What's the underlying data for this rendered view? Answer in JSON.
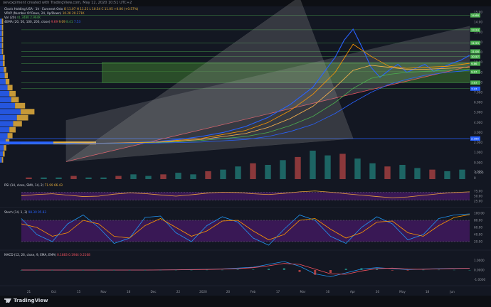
{
  "header": {
    "creator": "oevoxplment created with TradingView.com, May 12, 2020 10:51 UTC+2"
  },
  "legends": {
    "symbol": "Clovis Holding USA · 1h · Euronext Oslo",
    "symbol_values": "O 11.07  H 11.21  L 10.54  C 11.05  +0.06 (+0.57%)",
    "vrvp": "VRVP (Number Of Rows, 24, Up/Down)",
    "vrvp_values": "10.2K  20.271K",
    "vol": "Vol (20)",
    "vol_values": "41.348K  2.964K",
    "ema": "4EMA (20, 50, 100, 200, close)",
    "ema_values": [
      "9.69",
      "9.09",
      "8.41",
      "7.53"
    ],
    "rsi": "RSI (14, close, SMA, 14, 2)",
    "rsi_values": "71.99  66.43",
    "stoch": "Stoch (14, 1, 3)",
    "stoch_values": "98.30  95.83",
    "macd": "MACD (12, 26, close, 9, EMA, EMA)",
    "macd_values": "0.1883  0.1944  0.2168"
  },
  "brand": {
    "name": "TradingView"
  },
  "colors": {
    "background": "#131722",
    "candle_line": "#2962ff",
    "ema_fast": "#ff9800",
    "ema_mid": "#ffb74d",
    "ema_slow": "#4caf50",
    "ema_long": "#2962ff",
    "zone": "#3d7a2f",
    "channel": "#c8c8c8",
    "resistance": "#f7525f",
    "rsi_line": "#e8a33a",
    "stoch_k": "#2196f3",
    "stoch_d": "#ff9800",
    "band": "#4a1a6b",
    "profile_up": "#2962ff",
    "profile_down": "#e8b03c"
  },
  "chart_data": [
    {
      "type": "line",
      "role": "price",
      "x_ticks": [
        "21",
        "Oct",
        "15",
        "Nov",
        "18",
        "Dec",
        "22",
        "2020",
        "20",
        "Feb",
        "17",
        "Mar",
        "16",
        "Apr",
        "20",
        "May",
        "18",
        "Jun"
      ],
      "y_ticks": [
        "-1.000",
        "0.000",
        "1.000",
        "2.000",
        "3.000",
        "4.000",
        "5.000",
        "6.000",
        "7.000",
        "8.000",
        "9.000",
        "10.00",
        "11.00",
        "12.00",
        "13.00",
        "14.00",
        "15.00"
      ],
      "ylim": [
        -1.5,
        15.5
      ],
      "price_labels": [
        {
          "value": 14.68,
          "text": "14.68",
          "color": "#4caf50"
        },
        {
          "value": 13.24,
          "text": "13.24",
          "color": "#4caf50"
        },
        {
          "value": 11.93,
          "text": "11.93",
          "color": "#4caf50"
        },
        {
          "value": 11.08,
          "text": "11.08",
          "color": "#4caf50"
        },
        {
          "value": 10.57,
          "text": "10.57",
          "color": "#4caf50"
        },
        {
          "value": 9.86,
          "text": "9.86",
          "color": "#4caf50"
        },
        {
          "value": 9.07,
          "text": "9.07",
          "color": "#4caf50"
        },
        {
          "value": 7.97,
          "text": "7.97",
          "color": "#4caf50"
        },
        {
          "value": 7.37,
          "text": "7.37",
          "color": "#2962ff"
        },
        {
          "value": 2.395,
          "text": "2.395",
          "color": "#2962ff"
        }
      ],
      "series": [
        {
          "key": "price",
          "x": [
            0,
            5,
            10,
            15,
            20,
            25,
            30,
            35,
            40,
            45,
            50,
            55,
            60,
            65,
            70,
            72,
            74,
            76,
            78,
            80,
            82,
            84,
            86,
            88,
            90,
            92,
            94,
            96,
            98,
            100
          ],
          "values": [
            1.95,
            1.9,
            1.85,
            1.9,
            1.95,
            2.0,
            2.1,
            2.3,
            2.6,
            3.0,
            3.6,
            4.5,
            5.8,
            7.5,
            10.5,
            12.2,
            13.3,
            11.5,
            9.5,
            8.5,
            9.2,
            9.8,
            9.0,
            9.4,
            9.8,
            9.1,
            9.5,
            9.9,
            10.2,
            10.7
          ]
        },
        {
          "key": "ema20",
          "x": [
            0,
            10,
            20,
            30,
            40,
            50,
            55,
            60,
            65,
            70,
            74,
            78,
            82,
            86,
            90,
            95,
            100
          ],
          "values": [
            1.9,
            1.9,
            1.95,
            2.05,
            2.4,
            3.2,
            4.0,
            5.2,
            6.8,
            9.0,
            11.8,
            10.6,
            9.6,
            9.4,
            9.5,
            9.6,
            9.9
          ]
        },
        {
          "key": "ema50",
          "x": [
            0,
            10,
            20,
            30,
            40,
            50,
            55,
            60,
            65,
            70,
            74,
            78,
            82,
            86,
            90,
            95,
            100
          ],
          "values": [
            1.9,
            1.9,
            1.93,
            2.0,
            2.3,
            2.9,
            3.5,
            4.4,
            5.6,
            7.5,
            9.2,
            9.7,
            9.5,
            9.3,
            9.3,
            9.4,
            9.5
          ]
        },
        {
          "key": "ema100",
          "x": [
            0,
            10,
            20,
            30,
            40,
            50,
            55,
            60,
            65,
            70,
            74,
            78,
            82,
            86,
            90,
            95,
            100
          ],
          "values": [
            1.9,
            1.9,
            1.92,
            1.98,
            2.2,
            2.6,
            3.0,
            3.7,
            4.6,
            6.0,
            7.4,
            8.4,
            8.8,
            9.0,
            9.1,
            9.2,
            9.3
          ]
        },
        {
          "key": "ema200",
          "x": [
            0,
            10,
            20,
            30,
            40,
            50,
            55,
            60,
            65,
            70,
            74,
            78,
            82,
            86,
            90,
            95,
            100
          ],
          "values": [
            1.9,
            1.9,
            1.91,
            1.95,
            2.05,
            2.3,
            2.6,
            3.1,
            3.8,
            4.9,
            6.0,
            7.0,
            7.8,
            8.3,
            8.7,
            9.0,
            9.2
          ]
        }
      ],
      "zone": {
        "from_x": 18,
        "to_x": 100,
        "y_low": 7.97,
        "y_high": 10.0
      },
      "support_level": 2.395,
      "horizontal_levels": [
        14.68,
        13.24,
        11.93,
        11.08,
        10.57,
        9.86,
        9.07,
        7.97,
        7.37
      ],
      "channel": {
        "lower_start": [
          10,
          0.1
        ],
        "lower_end": [
          100,
          9.6
        ],
        "upper_start": [
          10,
          4.2
        ],
        "upper_end": [
          100,
          13.6
        ]
      },
      "resistance_triangle": {
        "top": [
          62,
          16.5
        ],
        "left": [
          10,
          0.1
        ],
        "bottom": [
          74,
          2.4
        ]
      }
    },
    {
      "type": "bar",
      "role": "volume",
      "x_ticks": [
        "0",
        "1.000"
      ],
      "values": [
        1,
        1,
        1,
        2,
        1,
        1,
        2,
        3,
        2,
        3,
        4,
        3,
        5,
        6,
        8,
        10,
        9,
        12,
        14,
        18,
        15,
        16,
        13,
        10,
        8,
        9,
        7,
        6,
        5,
        6
      ]
    },
    {
      "type": "line",
      "role": "rsi",
      "y_ticks": [
        "75.00",
        "50.00",
        "25.00"
      ],
      "ylim": [
        0,
        100
      ],
      "band": [
        30,
        70
      ],
      "values": [
        52,
        58,
        62,
        55,
        48,
        50,
        60,
        66,
        63,
        56,
        50,
        57,
        65,
        70,
        68,
        62,
        58,
        64,
        72,
        76,
        70,
        62,
        55,
        48,
        42,
        46,
        54,
        62,
        68,
        72
      ]
    },
    {
      "type": "line",
      "role": "stoch",
      "y_ticks": [
        "100.00",
        "80.00",
        "60.00",
        "40.00",
        "20.00"
      ],
      "ylim": [
        0,
        100
      ],
      "band": [
        20,
        80
      ],
      "series": [
        {
          "key": "k",
          "values": [
            85,
            40,
            20,
            70,
            95,
            60,
            15,
            30,
            88,
            92,
            45,
            20,
            65,
            90,
            75,
            30,
            10,
            55,
            95,
            80,
            35,
            15,
            60,
            90,
            70,
            25,
            40,
            85,
            95,
            98
          ]
        },
        {
          "key": "d",
          "values": [
            70,
            60,
            35,
            45,
            80,
            70,
            35,
            30,
            65,
            85,
            60,
            35,
            50,
            78,
            80,
            50,
            25,
            40,
            80,
            85,
            55,
            30,
            45,
            75,
            78,
            45,
            35,
            65,
            88,
            96
          ]
        }
      ]
    },
    {
      "type": "line",
      "role": "macd",
      "y_ticks": [
        "1.0000",
        "0.0000",
        "-1.0000"
      ],
      "ylim": [
        -1.5,
        1.5
      ],
      "series": [
        {
          "key": "macd",
          "values": [
            0,
            0,
            0,
            0,
            0,
            0,
            0,
            0,
            0,
            0.02,
            0.03,
            0.05,
            0.08,
            0.12,
            0.2,
            0.3,
            0.6,
            0.9,
            0.4,
            -0.4,
            -0.7,
            -0.3,
            0.1,
            0.25,
            0.15,
            0.05,
            0.1,
            0.15,
            0.18,
            0.19
          ]
        },
        {
          "key": "signal",
          "values": [
            0,
            0,
            0,
            0,
            0,
            0,
            0,
            0,
            0,
            0.01,
            0.02,
            0.04,
            0.06,
            0.1,
            0.15,
            0.25,
            0.45,
            0.7,
            0.6,
            0.1,
            -0.4,
            -0.45,
            -0.1,
            0.15,
            0.2,
            0.1,
            0.08,
            0.12,
            0.16,
            0.19
          ]
        }
      ]
    }
  ]
}
